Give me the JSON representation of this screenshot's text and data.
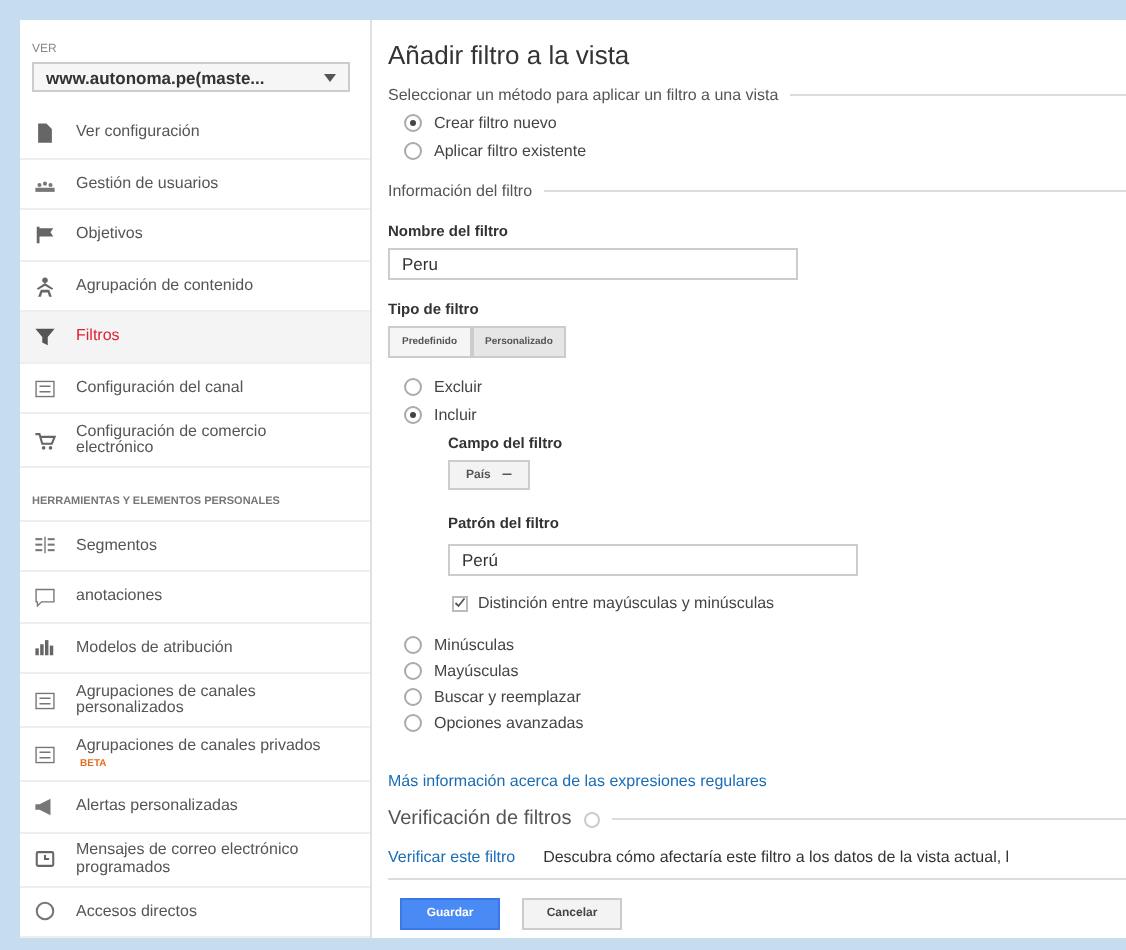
{
  "sidebar": {
    "view_label": "VER",
    "view_select": "www.autonoma.pe(maste...",
    "items": [
      {
        "label": "Ver configuración",
        "selected": false
      },
      {
        "label": "Gestión de usuarios",
        "selected": false
      },
      {
        "label": "Objetivos",
        "selected": false
      },
      {
        "label": "Agrupación de contenido",
        "selected": false
      },
      {
        "label": "Filtros",
        "selected": true
      },
      {
        "label": "Configuración del canal",
        "selected": false
      },
      {
        "label": "Configuración de comercio electrónico",
        "selected": false
      }
    ],
    "section_title": "HERRAMIENTAS Y ELEMENTOS PERSONALES",
    "tools": [
      {
        "label": "Segmentos",
        "selected": false
      },
      {
        "label": "anotaciones",
        "selected": false
      },
      {
        "label": "Modelos de atribución",
        "selected": false
      },
      {
        "label": "Agrupaciones de canales personalizados",
        "selected": false
      },
      {
        "label": "Agrupaciones de canales privados",
        "badge": "BETA",
        "selected": false
      },
      {
        "label": "Alertas personalizadas",
        "selected": false
      },
      {
        "label": "Mensajes de correo electrónico programados",
        "selected": false
      },
      {
        "label": "Accesos directos",
        "selected": false
      }
    ]
  },
  "main": {
    "title": "Añadir filtro a la vista",
    "method_heading": "Seleccionar un método para aplicar un filtro a una vista",
    "methods": [
      {
        "label": "Crear filtro nuevo",
        "selected": true
      },
      {
        "label": "Aplicar filtro existente",
        "selected": false
      }
    ],
    "info_heading": "Información del filtro",
    "name_label": "Nombre del filtro",
    "name_value": "Peru",
    "type_label": "Tipo de filtro",
    "type_tabs": [
      {
        "label": "Predefinido",
        "selected": false
      },
      {
        "label": "Personalizado",
        "selected": true
      }
    ],
    "options": [
      {
        "label": "Excluir",
        "selected": false
      },
      {
        "label": "Incluir",
        "selected": true
      }
    ],
    "field_label": "Campo del filtro",
    "field_select": "País",
    "pattern_label": "Patrón del filtro",
    "pattern_value": "Perú",
    "case_checkbox": {
      "label": "Distinción entre mayúsculas y minúsculas",
      "checked": true
    },
    "more_options": [
      {
        "label": "Minúsculas",
        "selected": false
      },
      {
        "label": "Mayúsculas",
        "selected": false
      },
      {
        "label": "Buscar y reemplazar",
        "selected": false
      },
      {
        "label": "Opciones avanzadas",
        "selected": false
      }
    ],
    "regex_link": "Más información acerca de las expresiones regulares",
    "verify_heading": "Verificación de filtros",
    "verify_link": "Verificar este filtro",
    "verify_text": "Descubra cómo afectaría este filtro a los datos de la vista actual, l",
    "buttons": [
      {
        "label": "Guardar",
        "kind": "primary"
      },
      {
        "label": "Cancelar",
        "kind": "secondary"
      }
    ]
  }
}
